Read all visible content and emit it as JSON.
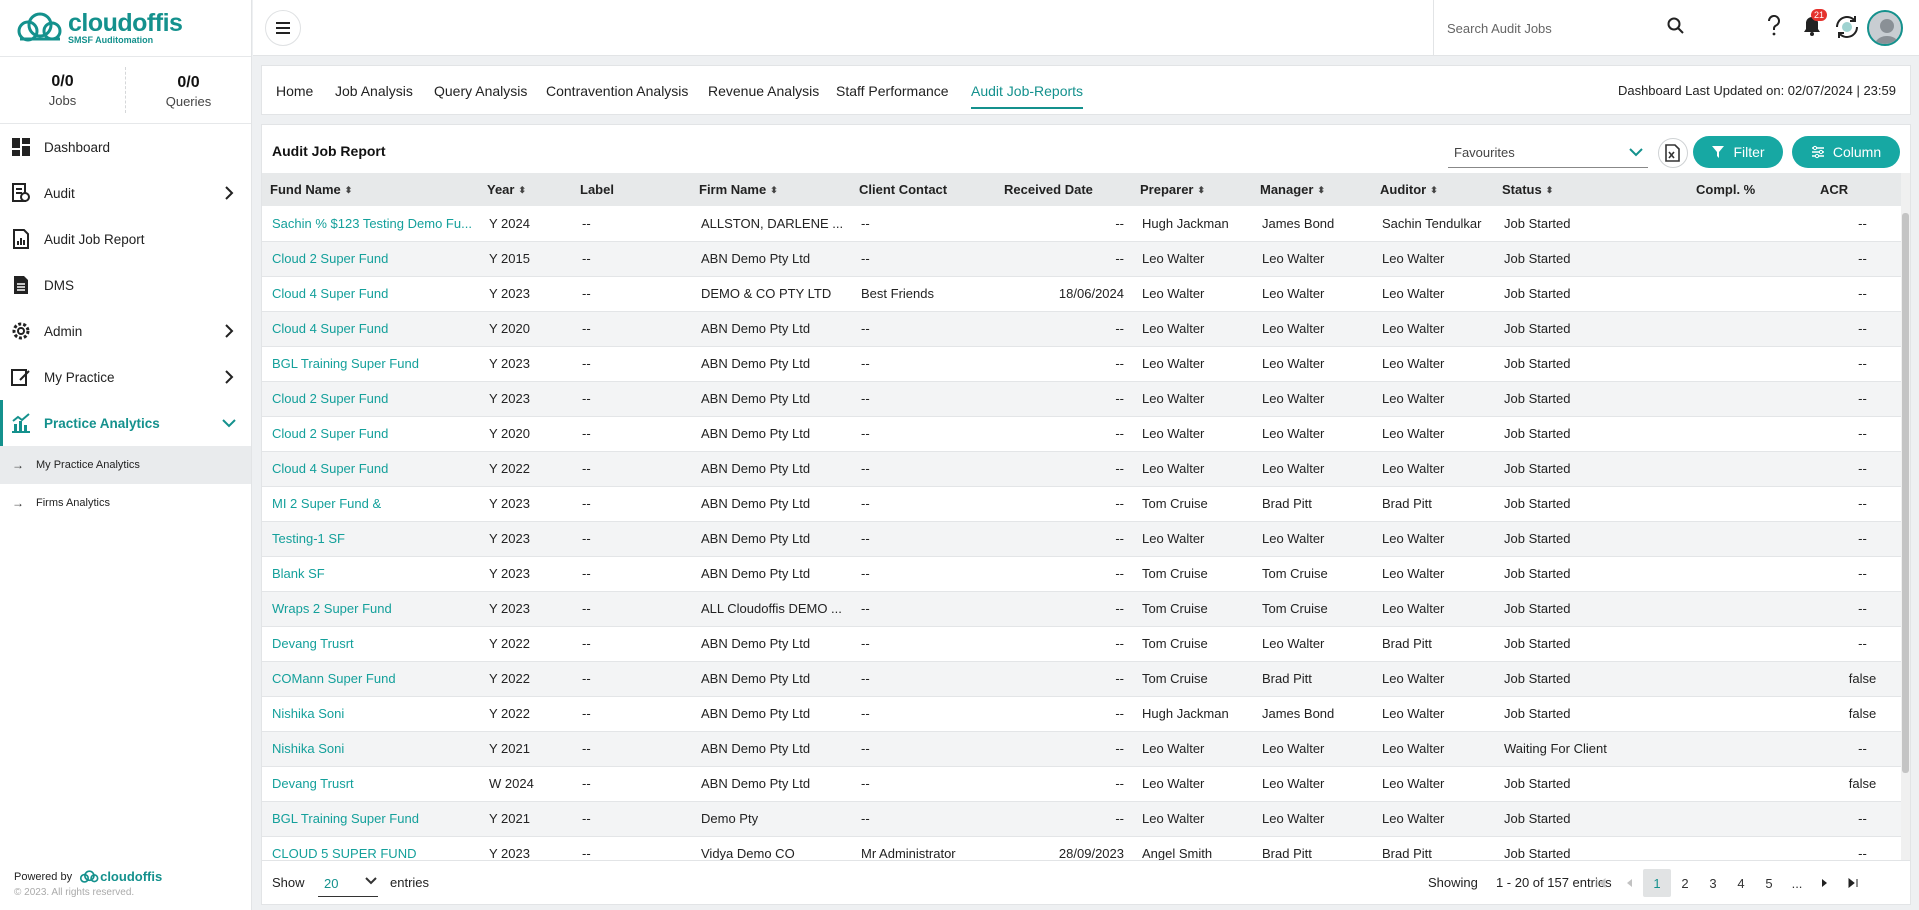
{
  "brand": {
    "name": "cloudoffis",
    "tagline": "SMSF Auditomation",
    "color": "#14918d"
  },
  "counts": {
    "jobs": {
      "value": "0/0",
      "label": "Jobs"
    },
    "queries": {
      "value": "0/0",
      "label": "Queries"
    }
  },
  "sidebar": {
    "items": [
      {
        "label": "Dashboard",
        "icon": "dashboard-icon"
      },
      {
        "label": "Audit",
        "icon": "audit-icon"
      },
      {
        "label": "Audit Job Report",
        "icon": "report-icon"
      },
      {
        "label": "DMS",
        "icon": "document-icon"
      },
      {
        "label": "Admin",
        "icon": "gear-icon"
      },
      {
        "label": "My Practice",
        "icon": "practice-icon"
      },
      {
        "label": "Practice Analytics",
        "icon": "analytics-icon"
      }
    ],
    "subitems": [
      {
        "label": "My Practice Analytics"
      },
      {
        "label": "Firms Analytics"
      }
    ],
    "powered_by": "Powered by",
    "powered_brand": "cloudoffis",
    "copyright": "© 2023. All rights reserved."
  },
  "header": {
    "search_placeholder": "Search Audit Jobs",
    "notification_count": "21"
  },
  "tabs": [
    "Home",
    "Job Analysis",
    "Query Analysis",
    "Contravention Analysis",
    "Revenue Analysis",
    "Staff Performance",
    "Audit Job-Reports"
  ],
  "last_updated": "Dashboard Last Updated on: 02/07/2024 | 23:59",
  "report": {
    "title": "Audit Job Report",
    "favourites_placeholder": "Favourites",
    "filter_label": "Filter",
    "column_label": "Column",
    "columns": [
      "Fund Name",
      "Year",
      "Label",
      "Firm Name",
      "Client Contact",
      "Received Date",
      "Preparer",
      "Manager",
      "Auditor",
      "Status",
      "Compl. %",
      "ACR"
    ],
    "rows": [
      [
        "Sachin % $123 Testing Demo Fu...",
        "Y 2024",
        "--",
        "ALLSTON, DARLENE ...",
        "--",
        "--",
        "Hugh Jackman",
        "James Bond",
        "Sachin Tendulkar",
        "Job Started",
        "",
        "--"
      ],
      [
        "Cloud 2 Super Fund",
        "Y 2015",
        "--",
        "ABN Demo Pty Ltd",
        "--",
        "--",
        "Leo Walter",
        "Leo Walter",
        "Leo Walter",
        "Job Started",
        "",
        "--"
      ],
      [
        "Cloud 4 Super Fund",
        "Y 2023",
        "--",
        "DEMO & CO PTY LTD",
        "Best Friends",
        "18/06/2024",
        "Leo Walter",
        "Leo Walter",
        "Leo Walter",
        "Job Started",
        "",
        "--"
      ],
      [
        "Cloud 4 Super Fund",
        "Y 2020",
        "--",
        "ABN Demo Pty Ltd",
        "--",
        "--",
        "Leo Walter",
        "Leo Walter",
        "Leo Walter",
        "Job Started",
        "",
        "--"
      ],
      [
        "BGL Training Super Fund",
        "Y 2023",
        "--",
        "ABN Demo Pty Ltd",
        "--",
        "--",
        "Leo Walter",
        "Leo Walter",
        "Leo Walter",
        "Job Started",
        "",
        "--"
      ],
      [
        "Cloud 2 Super Fund",
        "Y 2023",
        "--",
        "ABN Demo Pty Ltd",
        "--",
        "--",
        "Leo Walter",
        "Leo Walter",
        "Leo Walter",
        "Job Started",
        "",
        "--"
      ],
      [
        "Cloud 2 Super Fund",
        "Y 2020",
        "--",
        "ABN Demo Pty Ltd",
        "--",
        "--",
        "Leo Walter",
        "Leo Walter",
        "Leo Walter",
        "Job Started",
        "",
        "--"
      ],
      [
        "Cloud 4 Super Fund",
        "Y 2022",
        "--",
        "ABN Demo Pty Ltd",
        "--",
        "--",
        "Leo Walter",
        "Leo Walter",
        "Leo Walter",
        "Job Started",
        "",
        "--"
      ],
      [
        "MI 2 Super Fund &",
        "Y 2023",
        "--",
        "ABN Demo Pty Ltd",
        "--",
        "--",
        "Tom Cruise",
        "Brad Pitt",
        "Brad Pitt",
        "Job Started",
        "",
        "--"
      ],
      [
        "Testing-1 SF",
        "Y 2023",
        "--",
        "ABN Demo Pty Ltd",
        "--",
        "--",
        "Leo Walter",
        "Leo Walter",
        "Leo Walter",
        "Job Started",
        "",
        "--"
      ],
      [
        "Blank SF",
        "Y 2023",
        "--",
        "ABN Demo Pty Ltd",
        "--",
        "--",
        "Tom Cruise",
        "Tom Cruise",
        "Leo Walter",
        "Job Started",
        "",
        "--"
      ],
      [
        "Wraps 2 Super Fund",
        "Y 2023",
        "--",
        "ALL Cloudoffis DEMO ...",
        "--",
        "--",
        "Tom Cruise",
        "Tom Cruise",
        "Leo Walter",
        "Job Started",
        "",
        "--"
      ],
      [
        "Devang Trusrt",
        "Y 2022",
        "--",
        "ABN Demo Pty Ltd",
        "--",
        "--",
        "Tom Cruise",
        "Leo Walter",
        "Brad Pitt",
        "Job Started",
        "",
        "--"
      ],
      [
        "COMann Super Fund",
        "Y 2022",
        "--",
        "ABN Demo Pty Ltd",
        "--",
        "--",
        "Tom Cruise",
        "Brad Pitt",
        "Leo Walter",
        "Job Started",
        "",
        "false"
      ],
      [
        "Nishika Soni",
        "Y 2022",
        "--",
        "ABN Demo Pty Ltd",
        "--",
        "--",
        "Hugh Jackman",
        "James Bond",
        "Leo Walter",
        "Job Started",
        "",
        "false"
      ],
      [
        "Nishika Soni",
        "Y 2021",
        "--",
        "ABN Demo Pty Ltd",
        "--",
        "--",
        "Leo Walter",
        "Leo Walter",
        "Leo Walter",
        "Waiting For Client",
        "",
        "--"
      ],
      [
        "Devang Trusrt",
        "W 2024",
        "--",
        "ABN Demo Pty Ltd",
        "--",
        "--",
        "Leo Walter",
        "Leo Walter",
        "Leo Walter",
        "Job Started",
        "",
        "false"
      ],
      [
        "BGL Training Super Fund",
        "Y 2021",
        "--",
        "Demo Pty",
        "--",
        "--",
        "Leo Walter",
        "Leo Walter",
        "Leo Walter",
        "Job Started",
        "",
        "--"
      ],
      [
        "CLOUD 5 SUPER FUND",
        "Y 2023",
        "--",
        "Vidya Demo CO",
        "Mr Administrator",
        "28/09/2023",
        "Angel Smith",
        "Brad Pitt",
        "Brad Pitt",
        "Job Started",
        "",
        "--"
      ]
    ]
  },
  "pagination": {
    "show_label": "Show",
    "page_size": "20",
    "entries_label": "entries",
    "showing_label": "Showing",
    "range": "1 - 20 of 157 entries",
    "pages": [
      "1",
      "2",
      "3",
      "4",
      "5",
      "..."
    ],
    "current_page": "1"
  }
}
